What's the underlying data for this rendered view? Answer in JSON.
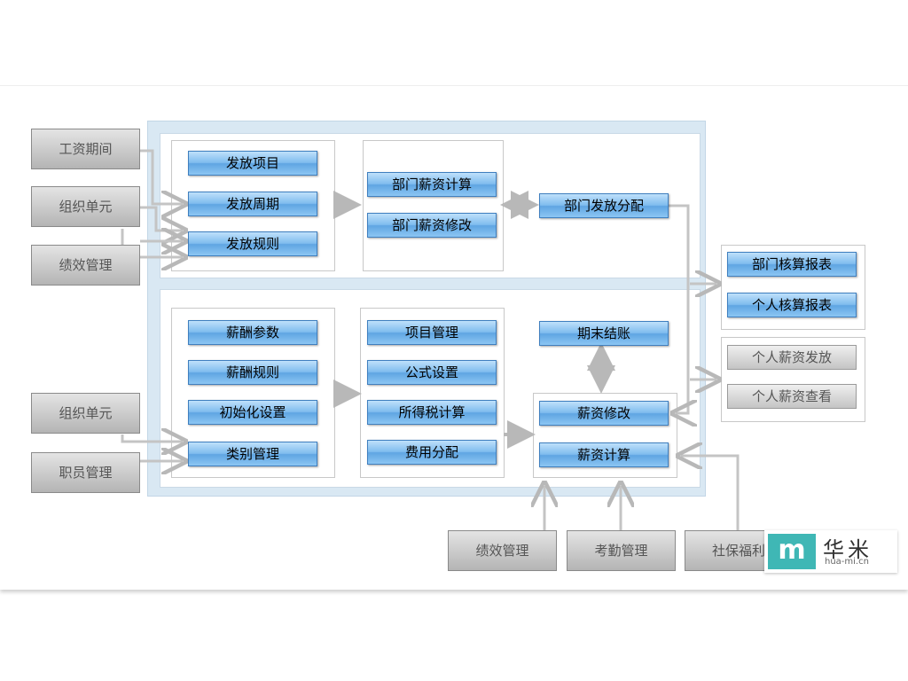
{
  "left_inputs_top": [
    "工资期间",
    "组织单元",
    "绩效管理"
  ],
  "top_col1": [
    "发放项目",
    "发放周期",
    "发放规则"
  ],
  "top_col2": [
    "部门薪资计算",
    "部门薪资修改"
  ],
  "top_col3": [
    "部门发放分配"
  ],
  "right_reports": [
    "部门核算报表",
    "个人核算报表"
  ],
  "right_personal": [
    "个人薪资发放",
    "个人薪资查看"
  ],
  "left_inputs_bottom": [
    "组织单元",
    "职员管理"
  ],
  "bottom_col1": [
    "薪酬参数",
    "薪酬规则",
    "初始化设置",
    "类别管理"
  ],
  "bottom_col2": [
    "项目管理",
    "公式设置",
    "所得税计算",
    "费用分配"
  ],
  "bottom_col3_top": [
    "期末结账"
  ],
  "bottom_col3": [
    "薪资修改",
    "薪资计算"
  ],
  "bottom_inputs": [
    "绩效管理",
    "考勤管理",
    "社保福利"
  ],
  "logo": {
    "mark": "m",
    "cn": "华米",
    "en": "hua-mi.cn",
    "color": "#3fb7b5"
  }
}
